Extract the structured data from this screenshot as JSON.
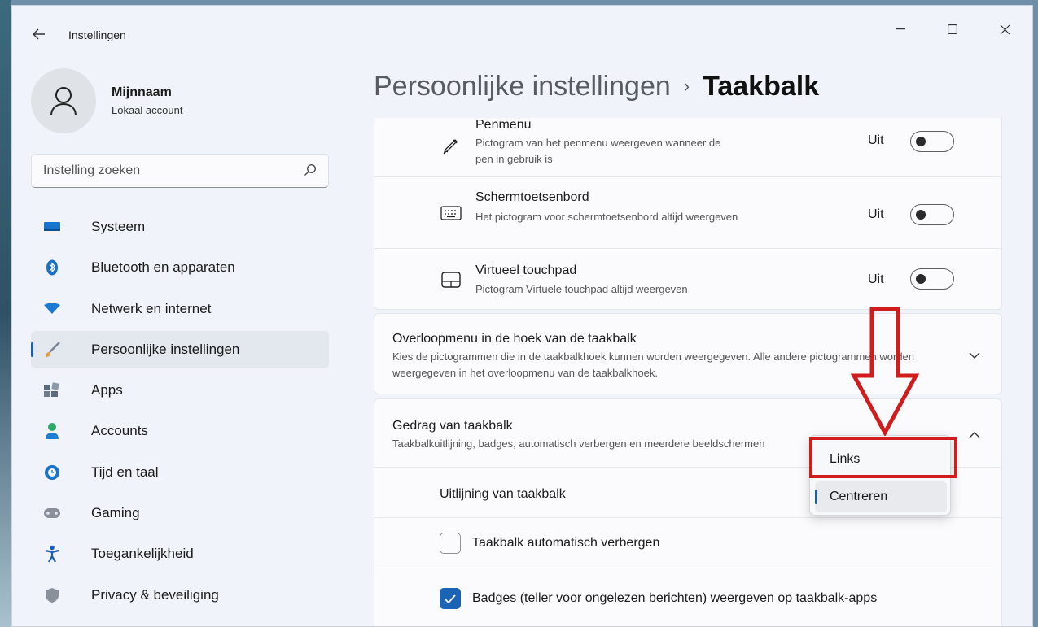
{
  "window": {
    "app_title": "Instellingen",
    "controls": {
      "minimize": "—",
      "maximize": "☐",
      "close": "✕"
    }
  },
  "profile": {
    "name": "Mijnnaam",
    "account_type": "Lokaal account"
  },
  "search": {
    "placeholder": "Instelling zoeken"
  },
  "nav": {
    "items": [
      {
        "label": "Systeem",
        "icon": "monitor-icon",
        "color": "#1a73c9"
      },
      {
        "label": "Bluetooth en apparaten",
        "icon": "bluetooth-icon",
        "color": "#1a6fc4"
      },
      {
        "label": "Netwerk en internet",
        "icon": "wifi-icon",
        "color": "#1a7ad4"
      },
      {
        "label": "Persoonlijke instellingen",
        "icon": "paintbrush-icon",
        "color": "#c77c2e",
        "active": true
      },
      {
        "label": "Apps",
        "icon": "apps-icon",
        "color": "#5b6a7b"
      },
      {
        "label": "Accounts",
        "icon": "person-icon",
        "color": "#2ea86a"
      },
      {
        "label": "Tijd en taal",
        "icon": "clock-globe-icon",
        "color": "#1a73c9"
      },
      {
        "label": "Gaming",
        "icon": "gamepad-icon",
        "color": "#8a9099"
      },
      {
        "label": "Toegankelijkheid",
        "icon": "accessibility-icon",
        "color": "#1a5fb4"
      },
      {
        "label": "Privacy & beveiliging",
        "icon": "shield-icon",
        "color": "#8a9099"
      }
    ]
  },
  "header": {
    "parent": "Persoonlijke instellingen",
    "separator": "›",
    "current": "Taakbalk"
  },
  "pen_rows": [
    {
      "title": "Penmenu",
      "desc": "Pictogram van het penmenu weergeven wanneer de pen in gebruik is",
      "state": "Uit",
      "icon": "pen-icon"
    },
    {
      "title": "Schermtoetsenbord",
      "desc": "Het pictogram voor schermtoetsenbord altijd weergeven",
      "state": "Uit",
      "icon": "keyboard-icon"
    },
    {
      "title": "Virtueel touchpad",
      "desc": "Pictogram Virtuele touchpad altijd weergeven",
      "state": "Uit",
      "icon": "touchpad-icon"
    }
  ],
  "overflow_section": {
    "title": "Overloopmenu in de hoek van de taakbalk",
    "desc": "Kies de pictogrammen die in de taakbalkhoek kunnen worden weergegeven. Alle andere pictogrammen worden weergegeven in het overloopmenu van de taakbalkhoek."
  },
  "behavior_section": {
    "title": "Gedrag van taakbalk",
    "desc": "Taakbalkuitlijning, badges, automatisch verbergen en meerdere beeldschermen",
    "alignment_label": "Uitlijning van taakbalk",
    "alignment_options": [
      "Links",
      "Centreren"
    ],
    "alignment_selected": "Centreren",
    "autohide": {
      "label": "Taakbalk automatisch verbergen",
      "checked": false
    },
    "badges": {
      "label": "Badges (teller voor ongelezen berichten) weergeven op taakbalk-apps",
      "checked": true
    }
  },
  "annotation": {
    "color": "#d01c1c"
  }
}
